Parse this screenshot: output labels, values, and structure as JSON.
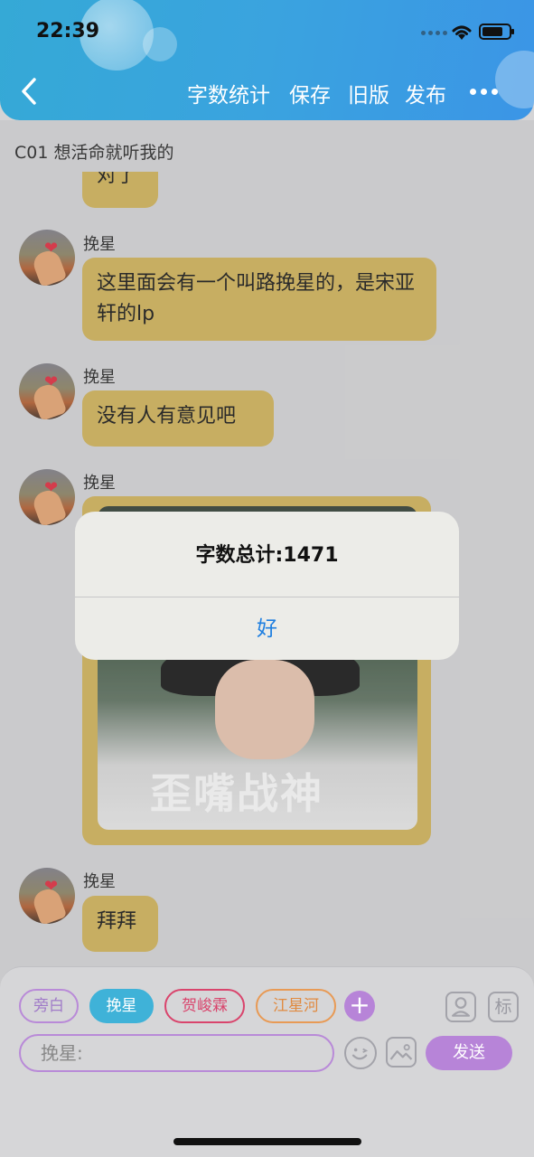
{
  "status_bar": {
    "time": "22:39"
  },
  "header": {
    "actions": [
      "字数统计",
      "保存",
      "旧版",
      "发布"
    ]
  },
  "chat": {
    "title": "C01 想活命就听我的",
    "partial_message": "对了",
    "messages": [
      {
        "sender": "挽星",
        "text": "这里面会有一个叫路挽星的，是宋亚轩的lp"
      },
      {
        "sender": "挽星",
        "text": "没有人有意见吧"
      },
      {
        "sender": "挽星",
        "image_caption": "歪嘴战神"
      },
      {
        "sender": "挽星",
        "text": "拜拜"
      }
    ]
  },
  "alert": {
    "title": "字数总计:1471",
    "button": "好"
  },
  "composer": {
    "roles": [
      "旁白",
      "挽星",
      "贺峻霖",
      "江星河"
    ],
    "input_placeholder": "挽星:",
    "send_label": "发送",
    "tag_label": "标"
  },
  "colors": {
    "header": "#3aa3df",
    "bubble": "#d0b155",
    "accent_purple": "#b784d8",
    "alert_button": "#1f7fe0"
  }
}
